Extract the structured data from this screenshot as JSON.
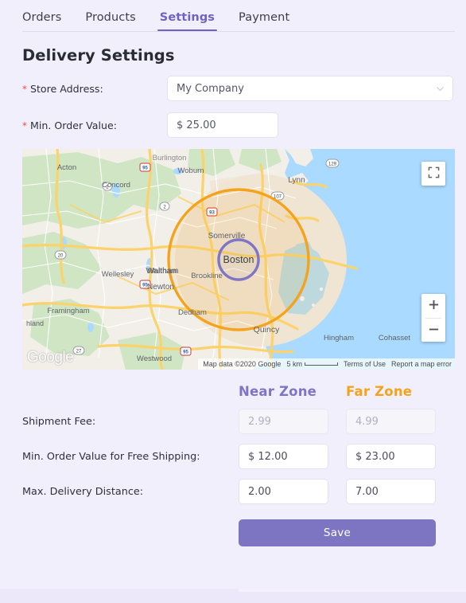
{
  "nav": {
    "tabs": [
      {
        "label": "Orders",
        "active": false
      },
      {
        "label": "Products",
        "active": false
      },
      {
        "label": "Settings",
        "active": true
      },
      {
        "label": "Payment",
        "active": false
      }
    ]
  },
  "page": {
    "title": "Delivery Settings"
  },
  "form": {
    "store_address": {
      "required_marker": "*",
      "label": "Store Address:",
      "value": "My Company",
      "icon": "chevron-down-icon"
    },
    "min_order_value": {
      "required_marker": "*",
      "label": "Min. Order Value:",
      "value": "$ 25.00"
    }
  },
  "map": {
    "center_label": "Boston",
    "attribution": "Map data ©2020 Google",
    "scale_label": "5 km",
    "terms_label": "Terms of Use",
    "report_label": "Report a map error",
    "logo_text": "Google",
    "fullscreen_icon": "fullscreen-icon",
    "zoom_in_icon": "plus-icon",
    "zoom_out_icon": "minus-icon",
    "near_zone_color": "#7e75c7",
    "far_zone_color": "#f4a31d",
    "water_color": "#aadaff",
    "land_color": "#f2efe9",
    "park_color": "#cfe5c4",
    "urban_color": "#f0e4d3",
    "road_color": "#fcd36a",
    "labels": [
      "Acton",
      "Concord",
      "Burlington",
      "Woburn",
      "Lynn",
      "Waltham",
      "Somerville",
      "Boston",
      "Brookline",
      "Newton",
      "Wellesley",
      "Framingham",
      "hland",
      "Dedham",
      "Westwood",
      "Quincy",
      "Hingham",
      "Cohasset"
    ],
    "shields": [
      "95",
      "2",
      "93",
      "107",
      "129",
      "20",
      "27",
      "95"
    ]
  },
  "zones": {
    "headers": [
      "Near Zone",
      "Far Zone"
    ],
    "rows": [
      {
        "label": "Shipment Fee:",
        "near": "2.99",
        "far": "4.99",
        "state": "disabled"
      },
      {
        "label": "Min. Order Value for Free Shipping:",
        "near": "$ 12.00",
        "far": "$ 23.00",
        "state": "enabled"
      },
      {
        "label": "Max. Delivery Distance:",
        "near": "2.00",
        "far": "7.00",
        "state": "enabled"
      }
    ]
  },
  "actions": {
    "save_label": "Save",
    "save_color": "#7d75c1"
  }
}
